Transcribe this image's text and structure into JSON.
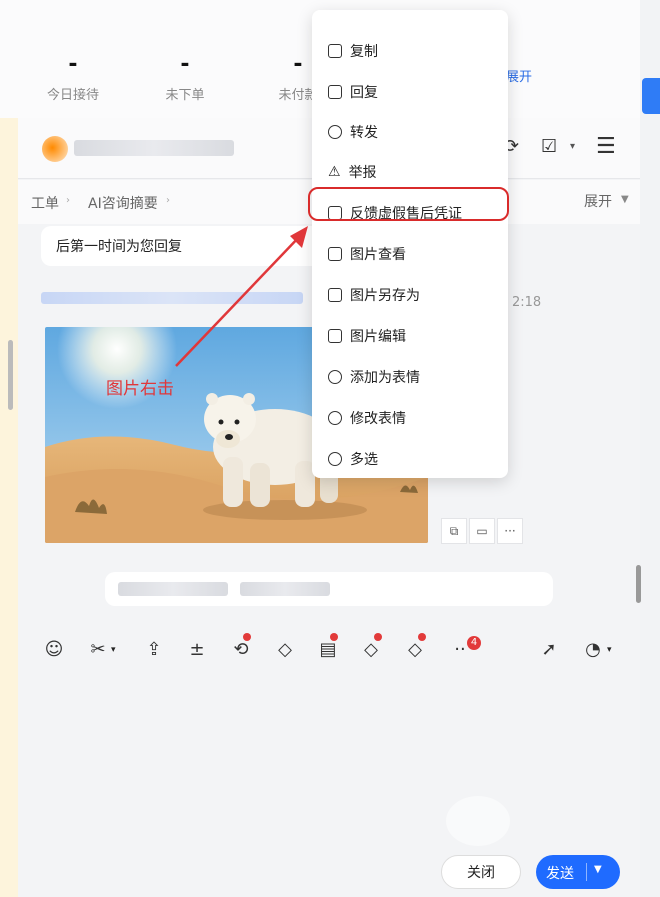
{
  "stats": {
    "items": [
      {
        "value": "-",
        "label": "今日接待"
      },
      {
        "value": "-",
        "label": "未下单"
      },
      {
        "value": "-",
        "label": "未付款"
      }
    ],
    "expand_label": "展开"
  },
  "tabs": {
    "items": [
      "工单",
      "AI咨询摘要"
    ],
    "expand_label": "展开"
  },
  "chat": {
    "bubble_text": "后第一时间为您回复",
    "time_fragment": "2:18"
  },
  "context_menu": {
    "items": [
      {
        "label": "复制",
        "icon": "copy-icon"
      },
      {
        "label": "回复",
        "icon": "reply-icon"
      },
      {
        "label": "转发",
        "icon": "forward-icon"
      },
      {
        "label": "举报",
        "icon": "warning-icon"
      },
      {
        "label": "反馈虚假售后凭证",
        "icon": "feedback-icon",
        "highlighted": true
      },
      {
        "label": "图片查看",
        "icon": "image-view-icon"
      },
      {
        "label": "图片另存为",
        "icon": "save-as-icon"
      },
      {
        "label": "图片编辑",
        "icon": "image-edit-icon"
      },
      {
        "label": "添加为表情",
        "icon": "add-emoji-icon"
      },
      {
        "label": "修改表情",
        "icon": "edit-emoji-icon"
      },
      {
        "label": "多选",
        "icon": "multi-select-icon"
      }
    ]
  },
  "annotation": {
    "text": "图片右击",
    "color": "#e0373a"
  },
  "toolbar": {
    "more_badge": "4"
  },
  "footer": {
    "close_label": "关闭",
    "send_label": "发送"
  },
  "colors": {
    "accent": "#1f6bff",
    "highlight_ring": "#d92b2b",
    "badge": "#e23a3a"
  }
}
